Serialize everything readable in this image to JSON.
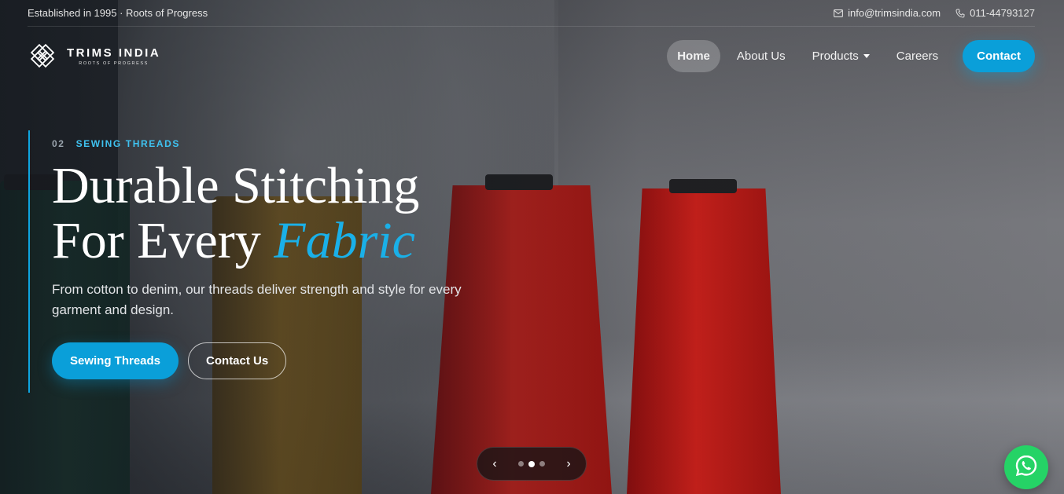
{
  "topbar": {
    "established": "Established in 1995 · Roots of Progress",
    "email": "info@trimsindia.com",
    "phone": "011-44793127"
  },
  "brand": {
    "name": "TRIMS INDIA",
    "tagline": "ROOTS OF PROGRESS"
  },
  "nav": {
    "home": "Home",
    "about": "About Us",
    "products": "Products",
    "careers": "Careers",
    "contact": "Contact"
  },
  "hero": {
    "slide_number": "02",
    "eyebrow": "SEWING THREADS",
    "headline_line1": "Durable Stitching",
    "headline_line2_prefix": "For Every ",
    "headline_accent": "Fabric",
    "subtitle": "From cotton to denim, our threads deliver strength and style for every garment and design.",
    "primary_button": "Sewing Threads",
    "secondary_button": "Contact Us"
  },
  "slider": {
    "prev_label": "‹",
    "next_label": "›",
    "current_slide": 2,
    "total_slides": 3
  },
  "colors": {
    "accent": "#0a9fd9",
    "whatsapp": "#25d366"
  },
  "icons": {
    "email": "mail-icon",
    "phone": "phone-icon",
    "whatsapp": "whatsapp-icon",
    "logo": "trims-logo-icon"
  }
}
